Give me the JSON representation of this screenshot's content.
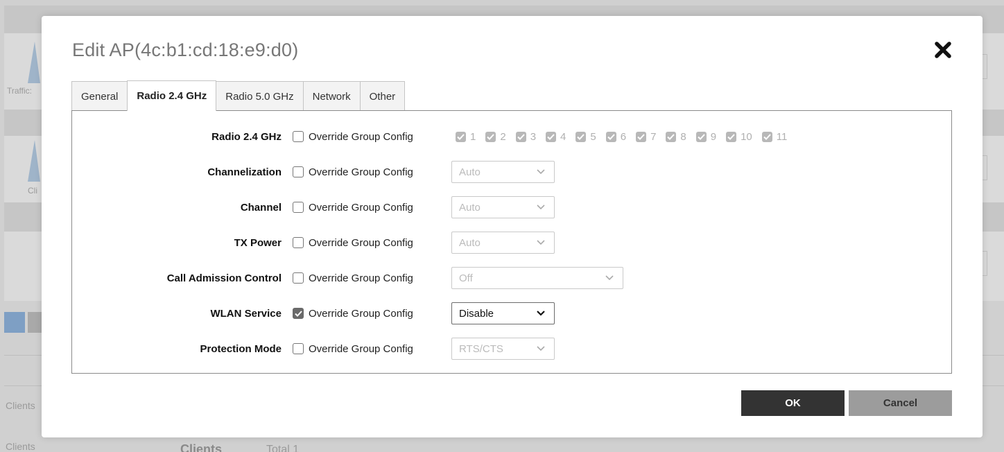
{
  "background": {
    "traffic_label": "Traffic:",
    "clients_label_short": "Cli",
    "clients_row1": "Clients",
    "clients_row2": "Clients",
    "clients_heading": "Clients",
    "total_label": "Total 1"
  },
  "modal": {
    "title": "Edit AP(4c:b1:cd:18:e9:d0)",
    "tabs": [
      {
        "label": "General",
        "active": false
      },
      {
        "label": "Radio 2.4 GHz",
        "active": true
      },
      {
        "label": "Radio 5.0 GHz",
        "active": false
      },
      {
        "label": "Network",
        "active": false
      },
      {
        "label": "Other",
        "active": false
      }
    ],
    "override_label": "Override Group Config",
    "rows": {
      "radio": {
        "label": "Radio 2.4 GHz",
        "override_checked": false
      },
      "channelization": {
        "label": "Channelization",
        "override_checked": false,
        "value": "Auto"
      },
      "channel": {
        "label": "Channel",
        "override_checked": false,
        "value": "Auto"
      },
      "tx_power": {
        "label": "TX Power",
        "override_checked": false,
        "value": "Auto"
      },
      "cac": {
        "label": "Call Admission Control",
        "override_checked": false,
        "value": "Off"
      },
      "wlan_service": {
        "label": "WLAN Service",
        "override_checked": true,
        "value": "Disable"
      },
      "protection_mode": {
        "label": "Protection Mode",
        "override_checked": false,
        "value": "RTS/CTS"
      }
    },
    "channels": [
      "1",
      "2",
      "3",
      "4",
      "5",
      "6",
      "7",
      "8",
      "9",
      "10",
      "11"
    ],
    "ok_label": "OK",
    "cancel_label": "Cancel"
  },
  "colors": {
    "primary_button": "#333333",
    "secondary_button": "#9c9c9c",
    "checked_box": "#6a6a6a"
  },
  "icons": {
    "close": "close-icon",
    "dropdown": "chevron-down-icon",
    "checkmark": "checkmark-icon"
  }
}
